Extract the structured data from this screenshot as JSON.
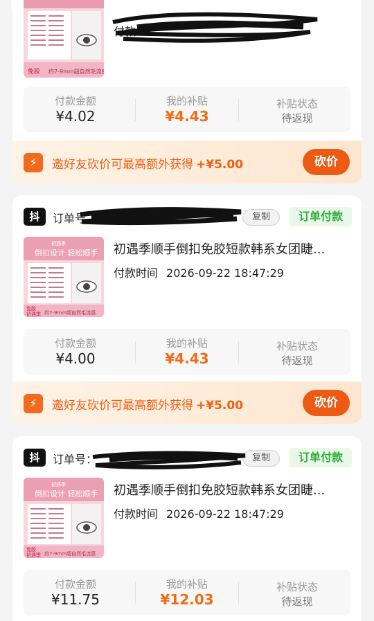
{
  "colors": {
    "accent": "#f26c17",
    "success": "#2ead3a",
    "page_bg": "#f4f4f4"
  },
  "icons": {
    "search": "search-icon",
    "platform": "douyin-icon",
    "bargain": "lightning-icon"
  },
  "orders": [
    {
      "pay_time_label": "付款",
      "pay_label": "付款金额",
      "pay_amount": "¥4.02",
      "subsidy_label": "我的补贴",
      "subsidy_amount": "¥4.43",
      "status_label": "补贴状态",
      "status_value": "待返现",
      "bargain_text": "邀好友砍价可最高额外获得",
      "bargain_amount": "+¥5.00",
      "bargain_button": "砍价"
    },
    {
      "platform": "抖",
      "order_label": "订单号",
      "copy_button": "复制",
      "order_status": "订单付款",
      "title": "初遇季顺手倒扣免胶短款韩系女团睫...",
      "pay_time_label": "付款时间",
      "pay_time": "2026-09-22 18:47:29",
      "pay_label": "付款金额",
      "pay_amount": "¥4.00",
      "subsidy_label": "我的补贴",
      "subsidy_amount": "¥4.43",
      "status_label": "补贴状态",
      "status_value": "待返现",
      "bargain_text": "邀好友砍价可最高额外获得",
      "bargain_amount": "+¥5.00",
      "bargain_button": "砍价"
    },
    {
      "platform": "抖",
      "order_label": "订单号：",
      "copy_button": "复制",
      "order_status": "订单付款",
      "title": "初遇季顺手倒扣免胶短款韩系女团睫...",
      "pay_time_label": "付款时间",
      "pay_time": "2026-09-22 18:47:29",
      "pay_label": "付款金额",
      "pay_amount": "¥11.75",
      "subsidy_label": "我的补贴",
      "subsidy_amount": "¥12.03",
      "status_label": "补贴状态",
      "status_value": "待返现"
    }
  ],
  "thumb": {
    "brand": "初遇季",
    "headline": "倒扣设计 轻松顺手",
    "tag": "免胶",
    "tag2": "初遇季",
    "length_text": "约7-9mm超自然毛流感"
  }
}
